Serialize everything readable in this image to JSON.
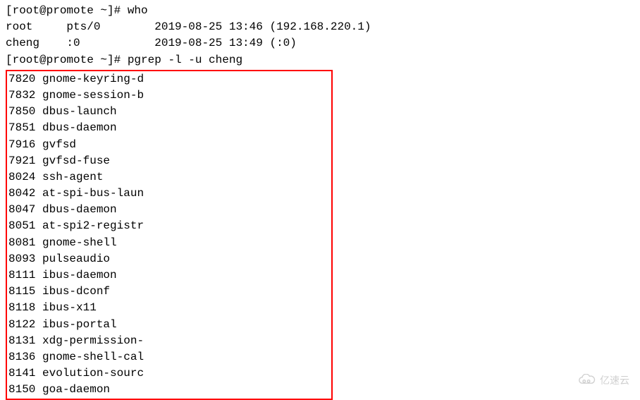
{
  "prompt1": "[root@promote ~]# ",
  "cmd1": "who",
  "who_output": [
    "root     pts/0        2019-08-25 13:46 (192.168.220.1)",
    "cheng    :0           2019-08-25 13:49 (:0)"
  ],
  "prompt2": "[root@promote ~]# ",
  "cmd2": "pgrep -l -u cheng",
  "pgrep_output": [
    {
      "pid": "7820",
      "name": "gnome-keyring-d"
    },
    {
      "pid": "7832",
      "name": "gnome-session-b"
    },
    {
      "pid": "7850",
      "name": "dbus-launch"
    },
    {
      "pid": "7851",
      "name": "dbus-daemon"
    },
    {
      "pid": "7916",
      "name": "gvfsd"
    },
    {
      "pid": "7921",
      "name": "gvfsd-fuse"
    },
    {
      "pid": "8024",
      "name": "ssh-agent"
    },
    {
      "pid": "8042",
      "name": "at-spi-bus-laun"
    },
    {
      "pid": "8047",
      "name": "dbus-daemon"
    },
    {
      "pid": "8051",
      "name": "at-spi2-registr"
    },
    {
      "pid": "8081",
      "name": "gnome-shell"
    },
    {
      "pid": "8093",
      "name": "pulseaudio"
    },
    {
      "pid": "8111",
      "name": "ibus-daemon"
    },
    {
      "pid": "8115",
      "name": "ibus-dconf"
    },
    {
      "pid": "8118",
      "name": "ibus-x11"
    },
    {
      "pid": "8122",
      "name": "ibus-portal"
    },
    {
      "pid": "8131",
      "name": "xdg-permission-"
    },
    {
      "pid": "8136",
      "name": "gnome-shell-cal"
    },
    {
      "pid": "8141",
      "name": "evolution-sourc"
    },
    {
      "pid": "8150",
      "name": "goa-daemon"
    }
  ],
  "watermark_text": "亿速云"
}
